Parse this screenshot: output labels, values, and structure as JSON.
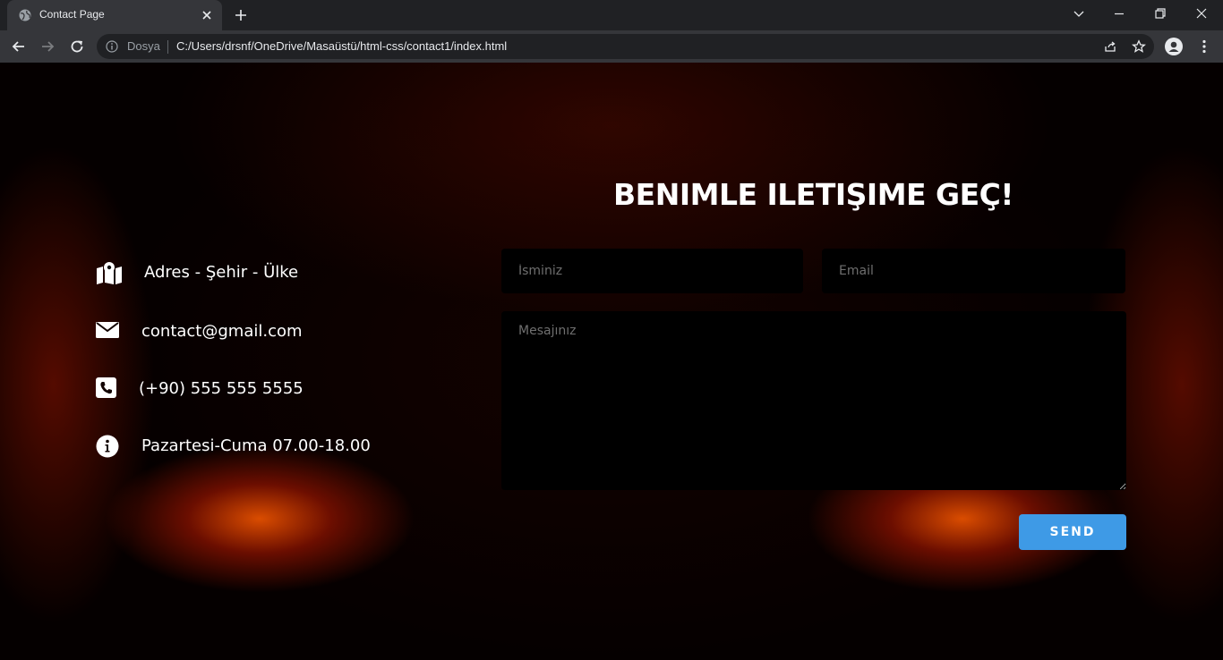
{
  "browser": {
    "tab_title": "Contact Page",
    "url_scheme": "Dosya",
    "url": "C:/Users/drsnf/OneDrive/Masaüstü/html-css/contact1/index.html"
  },
  "contact": {
    "heading": "BENIMLE ILETIŞIME GEÇ!",
    "info": [
      {
        "icon": "map-icon",
        "text": "Adres - Şehir - Ülke"
      },
      {
        "icon": "envelope-icon",
        "text": "contact@gmail.com"
      },
      {
        "icon": "phone-icon",
        "text": "(+90) 555 555 5555"
      },
      {
        "icon": "info-icon",
        "text": "Pazartesi-Cuma 07.00-18.00"
      }
    ],
    "form": {
      "name_placeholder": "İsminiz",
      "email_placeholder": "Email",
      "message_placeholder": "Mesajınız",
      "send_label": "SEND"
    }
  },
  "colors": {
    "accent": "#3e9ae6",
    "field_bg": "#000000",
    "chrome_bg": "#202124",
    "toolbar_bg": "#35363a"
  }
}
